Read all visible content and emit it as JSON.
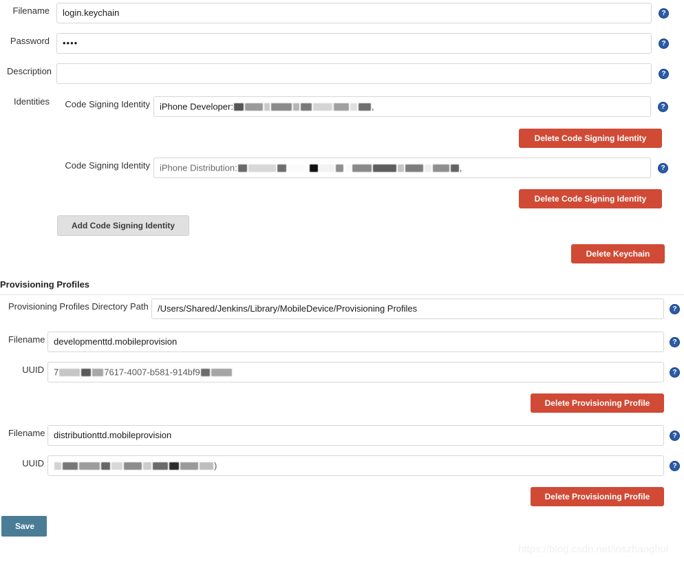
{
  "keychain": {
    "filename": {
      "label": "Filename",
      "value": "login.keychain"
    },
    "password": {
      "label": "Password",
      "value": "••••"
    },
    "description": {
      "label": "Description",
      "value": ""
    },
    "identities_label": "Identities",
    "identities": [
      {
        "label": "Code Signing Identity",
        "value": "iPhone Developer:",
        "redacted": true,
        "delete_label": "Delete Code Signing Identity"
      },
      {
        "label": "Code Signing Identity",
        "value": "iPhone Distribution:",
        "redacted": true,
        "delete_label": "Delete Code Signing Identity"
      }
    ],
    "add_identity_label": "Add Code Signing Identity",
    "delete_keychain_label": "Delete Keychain"
  },
  "provisioning": {
    "section_title": "Provisioning Profiles",
    "directory": {
      "label": "Provisioning Profiles Directory Path",
      "value": "/Users/Shared/Jenkins/Library/MobileDevice/Provisioning Profiles"
    },
    "profiles": [
      {
        "filename_label": "Filename",
        "filename_value": "developmenttd.mobileprovision",
        "uuid_label": "UUID",
        "uuid_value": "7617-4007-b581-914bf9",
        "uuid_redacted": true,
        "delete_label": "Delete Provisioning Profile"
      },
      {
        "filename_label": "Filename",
        "filename_value": "distributionttd.mobileprovision",
        "uuid_label": "UUID",
        "uuid_value": "",
        "uuid_redacted": true,
        "delete_label": "Delete Provisioning Profile"
      }
    ]
  },
  "footer": {
    "save_label": "Save",
    "watermark": "https://blog.csdn.net/ioszhanghui"
  },
  "icons": {
    "help": "?"
  },
  "colors": {
    "danger": "#d04a35",
    "save": "#4a7c96",
    "help": "#2b5ba8",
    "field_border": "#d6d6d6"
  }
}
